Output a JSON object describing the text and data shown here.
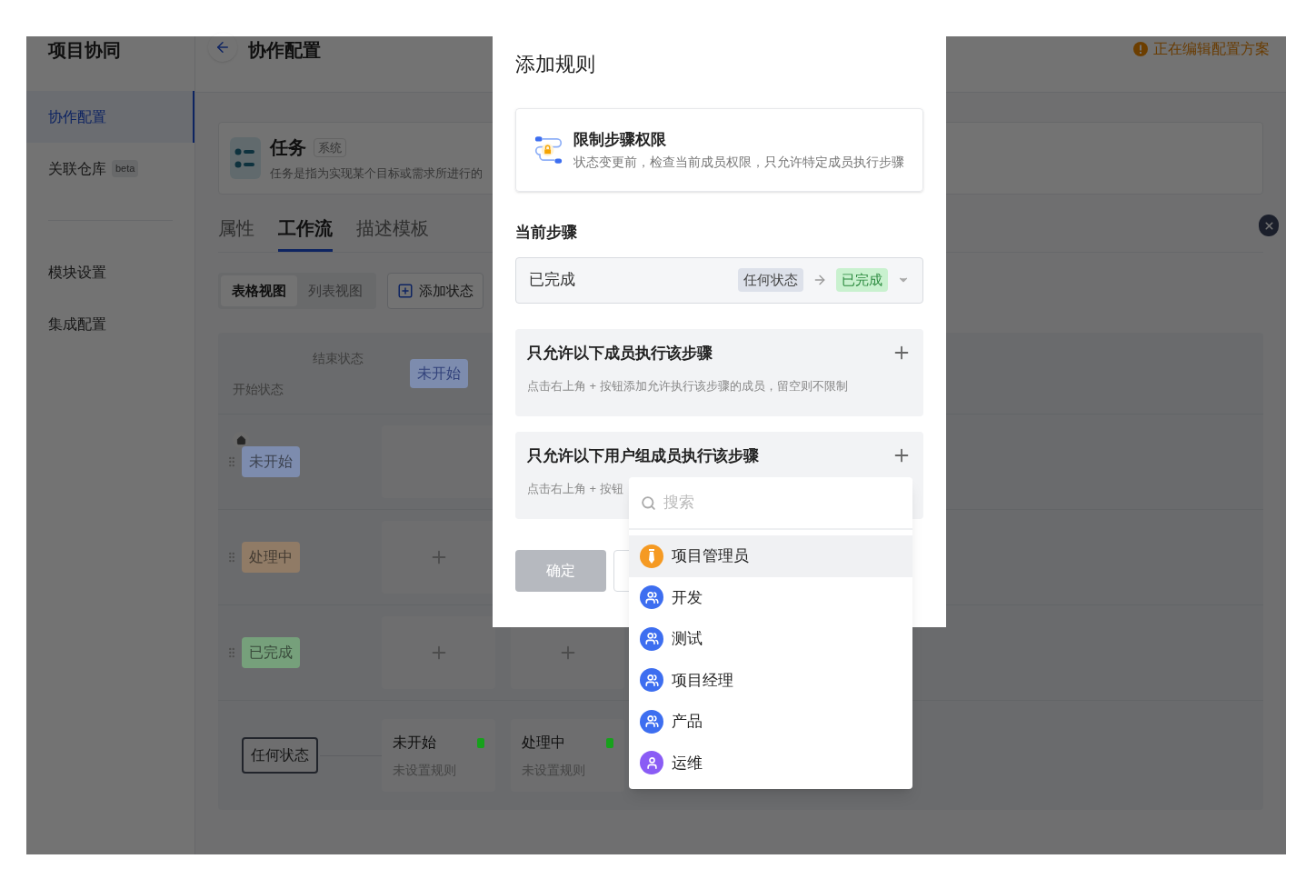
{
  "app": {
    "title": "项目协同",
    "sidebar": {
      "groups": [
        [
          {
            "label": "协作配置",
            "selected": true
          },
          {
            "label": "关联仓库",
            "selected": false,
            "badge": "beta"
          }
        ],
        [
          {
            "label": "模块设置",
            "selected": false
          },
          {
            "label": "集成配置",
            "selected": false
          }
        ]
      ]
    },
    "header": {
      "title": "协作配置",
      "notice": "正在编辑配置方案"
    },
    "type_card": {
      "name": "任务",
      "tag": "系统",
      "description": "任务是指为实现某个目标或需求所进行的"
    },
    "tabs": [
      {
        "label": "属性",
        "selected": false
      },
      {
        "label": "工作流",
        "selected": true
      },
      {
        "label": "描述模板",
        "selected": false
      }
    ],
    "views": [
      {
        "label": "表格视图",
        "selected": true
      },
      {
        "label": "列表视图",
        "selected": false
      }
    ],
    "add_state": "添加状态",
    "matrix": {
      "end_label": "结束状态",
      "start_label": "开始状态",
      "columns": [
        {
          "label": "未开始",
          "color": "#7d8cae"
        }
      ],
      "rows": [
        {
          "state": "未开始",
          "color": "#7d8cae",
          "home": true,
          "cells": [
            {
              "kind": "empty"
            }
          ]
        },
        {
          "state": "处理中",
          "color": "#907b66",
          "home": false,
          "cells": [
            {
              "kind": "plus"
            }
          ]
        },
        {
          "state": "已完成",
          "color": "#76a07b",
          "home": false,
          "cells": [
            {
              "kind": "plus"
            },
            {
              "kind": "plus"
            }
          ]
        }
      ],
      "any_state": "任何状态",
      "transitions": [
        {
          "state": "未开始",
          "rule": "未设置规则",
          "color": "#17a11c"
        },
        {
          "state": "处理中",
          "rule": "未设置规则",
          "color": "#17a11c"
        }
      ]
    }
  },
  "modal": {
    "title": "添加规则",
    "rule": {
      "title": "限制步骤权限",
      "description": "状态变更前，检查当前成员权限，只允许特定成员执行步骤"
    },
    "step_label": "当前步骤",
    "step_select": {
      "value": "已完成",
      "from": "任何状态",
      "to": "已完成"
    },
    "sections": [
      {
        "title": "只允许以下成员执行该步骤",
        "hint": "点击右上角 + 按钮添加允许执行该步骤的成员，留空则不限制"
      },
      {
        "title": "只允许以下用户组成员执行该步骤",
        "hint": "点击右上角 + 按钮"
      }
    ],
    "confirm": {
      "label": "确定",
      "disabled": true
    }
  },
  "dropdown": {
    "search": {
      "placeholder": "搜索"
    },
    "items": [
      {
        "label": "项目管理员",
        "kind": "admin",
        "selected": true
      },
      {
        "label": "开发",
        "kind": "group",
        "selected": false
      },
      {
        "label": "测试",
        "kind": "group",
        "selected": false
      },
      {
        "label": "项目经理",
        "kind": "group",
        "selected": false
      },
      {
        "label": "产品",
        "kind": "group",
        "selected": false
      },
      {
        "label": "运维",
        "kind": "user",
        "selected": false
      }
    ]
  }
}
